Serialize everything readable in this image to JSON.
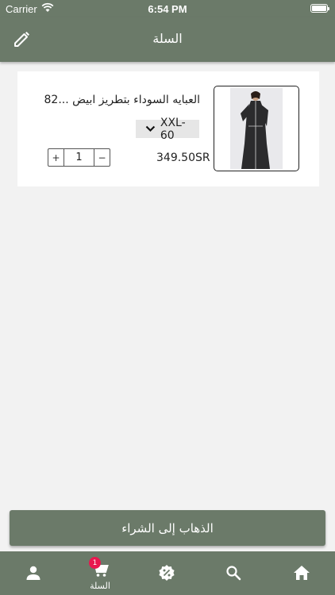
{
  "status_bar": {
    "carrier": "Carrier",
    "time": "6:54 PM"
  },
  "header": {
    "title": "السلة",
    "edit_icon": "pencil-icon"
  },
  "cart": {
    "items": [
      {
        "name": "العبايه السوداء بتطريز ابيض ...82",
        "size": "XXL-60",
        "price": "349.50SR",
        "quantity": "1",
        "increment_label": "+",
        "decrement_label": "−"
      }
    ]
  },
  "checkout_button": {
    "label": "الذهاب إلى الشراء"
  },
  "tab_bar": {
    "tabs": [
      {
        "icon": "person-icon",
        "label": ""
      },
      {
        "icon": "cart-icon",
        "label": "السلة",
        "badge": "1",
        "active": true
      },
      {
        "icon": "discount-icon",
        "label": ""
      },
      {
        "icon": "search-icon",
        "label": ""
      },
      {
        "icon": "home-icon",
        "label": ""
      }
    ]
  },
  "colors": {
    "primary": "#6b7a69",
    "badge": "#e8174f",
    "background": "#f2f2f2"
  }
}
